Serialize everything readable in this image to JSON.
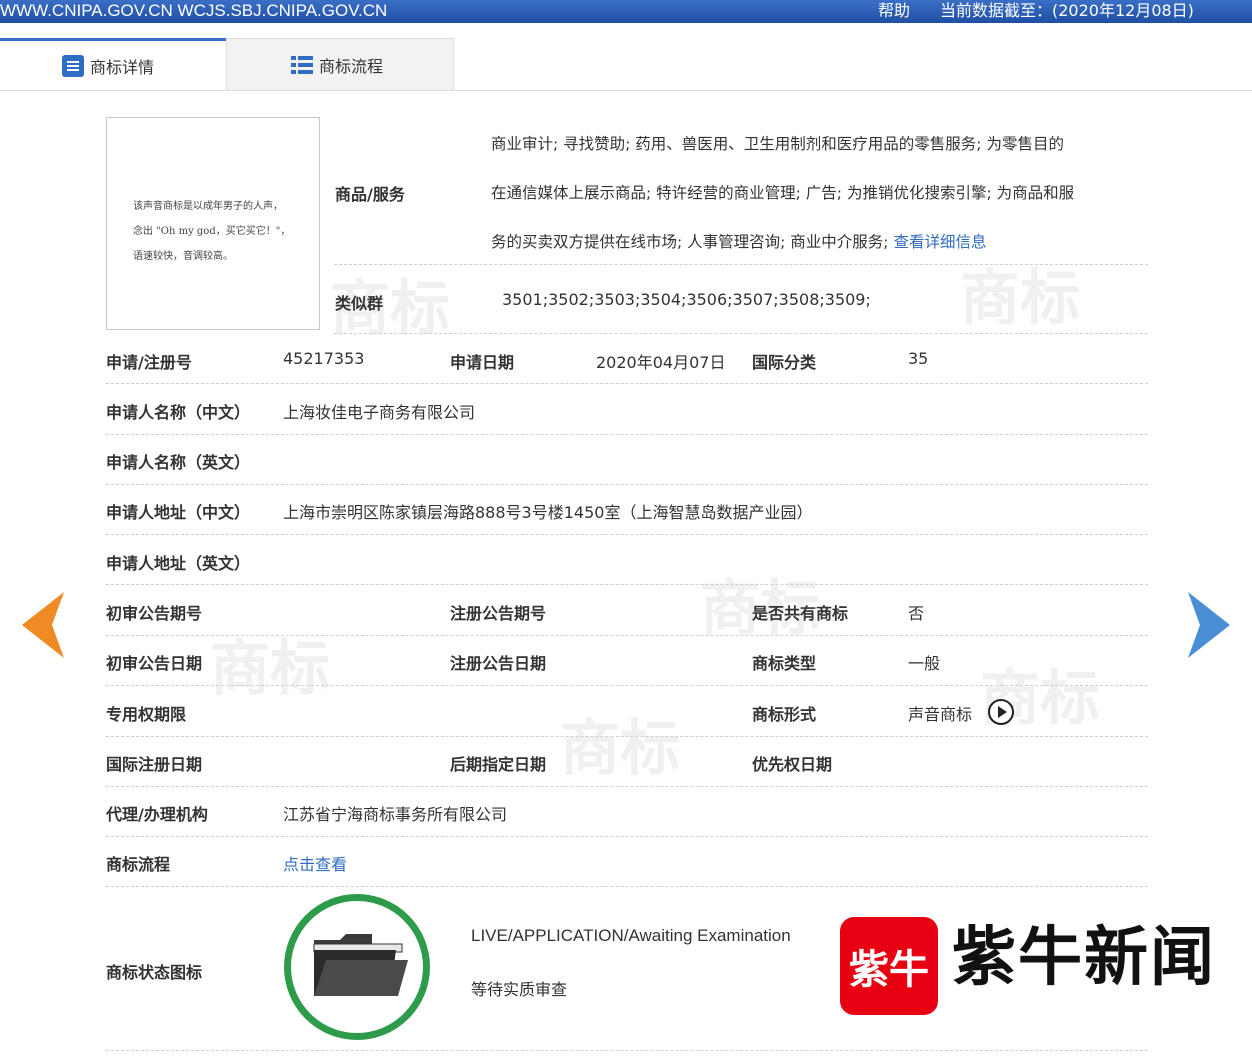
{
  "topbar": {
    "site": "WWW.CNIPA.GOV.CN WCJS.SBJ.CNIPA.GOV.CN",
    "help": "帮助",
    "data_date": "当前数据截至：(2020年12月08日)"
  },
  "tabs": [
    {
      "label": "商标详情"
    },
    {
      "label": "商标流程"
    }
  ],
  "watermark": "商标",
  "image": {
    "text_lines": [
      "该声音商标是以成年男子的人声，",
      "念出 \"Oh my god，买它买它！\"，",
      "语速较快，音调较高。"
    ]
  },
  "goods": {
    "label": "商品/服务",
    "lines": [
      "商业审计; 寻找赞助; 药用、兽医用、卫生用制剂和医疗用品的零售服务; 为零售目的",
      "在通信媒体上展示商品; 特许经营的商业管理; 广告; 为推销优化搜索引擎; 为商品和服",
      "务的买卖双方提供在线市场; 人事管理咨询; 商业中介服务; "
    ],
    "more_link": "查看详细信息"
  },
  "similar": {
    "label": "类似群",
    "value": "3501;3502;3503;3504;3506;3507;3508;3509;"
  },
  "fields": {
    "reg_no_label": "申请/注册号",
    "reg_no": "45217353",
    "app_date_label": "申请日期",
    "app_date": "2020年04月07日",
    "intl_class_label": "国际分类",
    "intl_class": "35",
    "name_cn_label": "申请人名称（中文）",
    "name_cn": "上海妆佳电子商务有限公司",
    "name_en_label": "申请人名称（英文）",
    "addr_cn_label": "申请人地址（中文）",
    "addr_cn": "上海市崇明区陈家镇层海路888号3号楼1450室（上海智慧岛数据产业园）",
    "addr_en_label": "申请人地址（英文）",
    "prelim_no_label": "初审公告期号",
    "reg_pub_no_label": "注册公告期号",
    "shared_label": "是否共有商标",
    "shared": "否",
    "prelim_date_label": "初审公告日期",
    "reg_pub_date_label": "注册公告日期",
    "tm_type_label": "商标类型",
    "tm_type": "一般",
    "exclusive_label": "专用权期限",
    "tm_form_label": "商标形式",
    "tm_form": "声音商标",
    "intl_reg_label": "国际注册日期",
    "later_label": "后期指定日期",
    "priority_label": "优先权日期",
    "agent_label": "代理/办理机构",
    "agent": "江苏省宁海商标事务所有限公司",
    "flow_label": "商标流程",
    "flow_link": "点击查看",
    "status_label": "商标状态图标",
    "status_en": "LIVE/APPLICATION/Awaiting Examination",
    "status_cn": "等待实质审查"
  },
  "logo": {
    "badge": "紫牛",
    "name": "紫牛新闻"
  },
  "colors": {
    "brand_blue": "#2f6cc3",
    "status_green": "#2e9b4a",
    "prev_arrow": "#f08a24",
    "next_arrow": "#4a8fd6",
    "logo_red": "#e60012"
  }
}
